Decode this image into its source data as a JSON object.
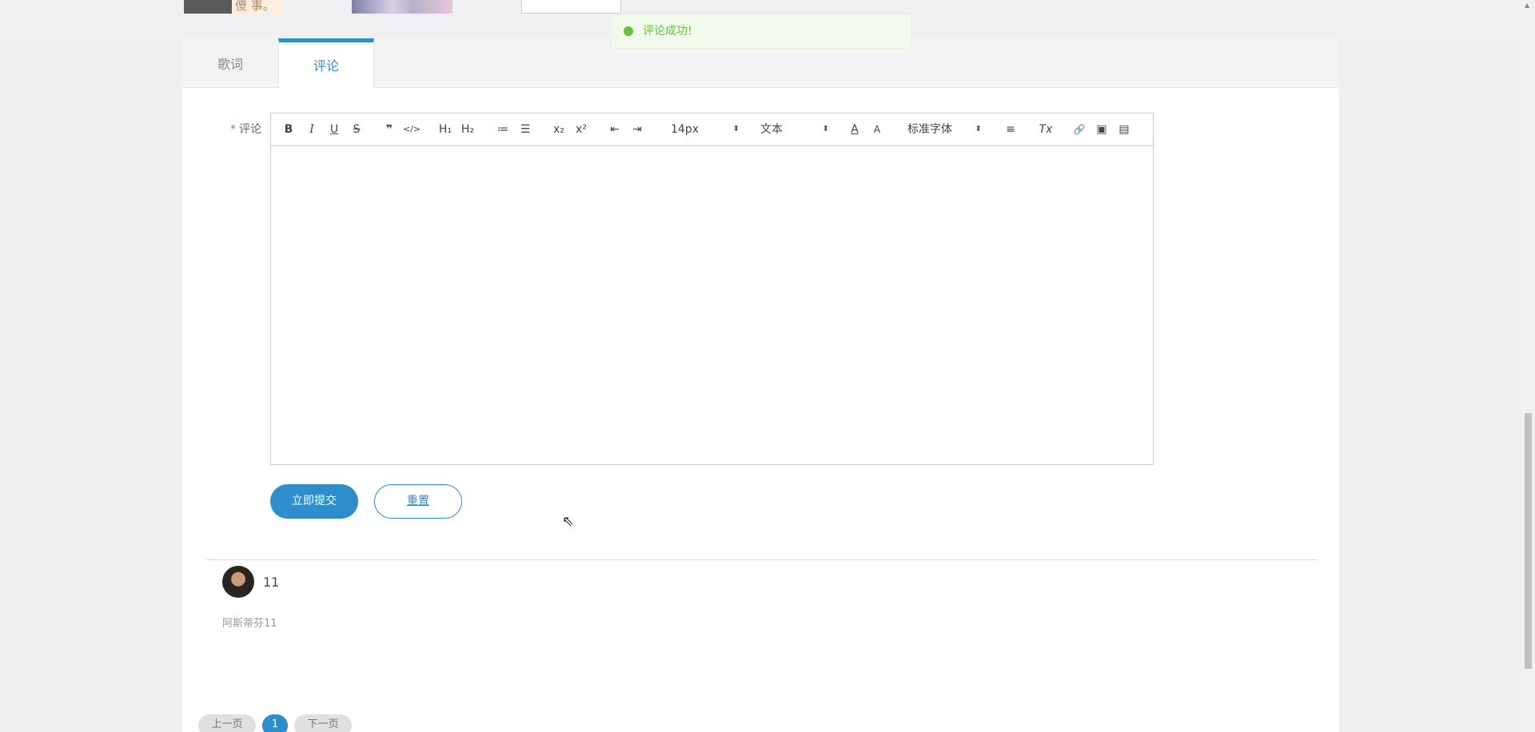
{
  "top_strip": {
    "thumb1_text": "傻 事。"
  },
  "tabs": [
    {
      "label": "歌词"
    },
    {
      "label": "评论"
    }
  ],
  "form": {
    "required_mark": "*",
    "label": "评论"
  },
  "toolbar": {
    "bold": "B",
    "italic": "I",
    "underline": "U",
    "strike": "S",
    "quote": "❞",
    "code": "</>",
    "h1": "H₁",
    "h2": "H₂",
    "ordered_list": "≔",
    "bullet_list": "☰",
    "subscript": "x₂",
    "superscript": "x²",
    "outdent": "⇤",
    "indent": "⇥",
    "size_value": "14px",
    "size_arrow": "⬍",
    "header_value": "文本",
    "header_arrow": "⬍",
    "color": "A",
    "background": "A",
    "font_value": "标准字体",
    "font_arrow": "⬍",
    "align": "≡",
    "clean": "Tx",
    "link": "🔗",
    "image": "▣",
    "video": "▤"
  },
  "buttons": {
    "submit": "立即提交",
    "reset": "重置"
  },
  "comments": [
    {
      "text": "11",
      "user": "阿斯蒂芬11"
    }
  ],
  "pagination": {
    "prev": "上一页",
    "current": "1",
    "next": "下一页"
  },
  "toast": {
    "message": "评论成功!"
  },
  "colors": {
    "accent": "#2e8dcb",
    "success": "#67c23a"
  }
}
